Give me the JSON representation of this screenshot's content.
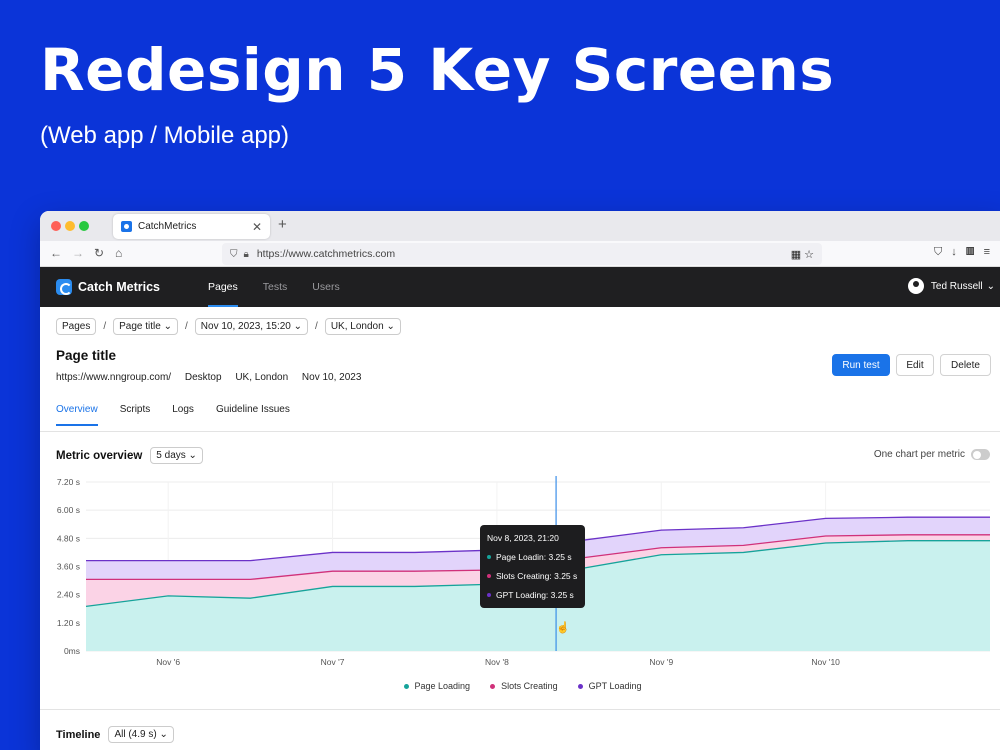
{
  "hero": {
    "title": "Redesign 5 Key Screens",
    "subtitle": "(Web app / Mobile app)"
  },
  "browser": {
    "tab_title": "CatchMetrics",
    "url": "https://www.catchmetrics.com"
  },
  "app": {
    "brand": "Catch Metrics",
    "nav": [
      "Pages",
      "Tests",
      "Users"
    ],
    "active_nav": "Pages",
    "user_name": "Ted Russell",
    "user_caret": "⌄"
  },
  "breadcrumb": {
    "root": "Pages",
    "page": "Page title",
    "date": "Nov 10, 2023, 15:20",
    "location": "UK, London",
    "caret": "⌄",
    "separator": "/"
  },
  "page": {
    "title": "Page title",
    "url": "https://www.nngroup.com/",
    "device": "Desktop",
    "location": "UK, London",
    "date": "Nov 10, 2023"
  },
  "actions": {
    "run": "Run test",
    "edit": "Edit",
    "delete": "Delete"
  },
  "tabs": [
    "Overview",
    "Scripts",
    "Logs",
    "Guideline Issues"
  ],
  "metric": {
    "title": "Metric overview",
    "range": "5 days",
    "per_metric_label": "One chart per metric",
    "per_metric_on": false
  },
  "tooltip": {
    "title": "Nov 8, 2023,  21:20",
    "rows": [
      {
        "label": "Page Loadin: 3.25 s",
        "color": "#16a39a"
      },
      {
        "label": "Slots Creating: 3.25 s",
        "color": "#d0317a"
      },
      {
        "label": "GPT Loading: 3.25 s",
        "color": "#6b32c8"
      }
    ]
  },
  "timeline": {
    "title": "Timeline",
    "range": "All (4.9 s)"
  },
  "chart_data": {
    "type": "area",
    "x": [
      "Nov 5 00:00",
      "Nov 6 00:00",
      "Nov 6 12:00",
      "Nov 7 00:00",
      "Nov 7 12:00",
      "Nov 8 00:00",
      "Nov 8 12:00",
      "Nov 9 00:00",
      "Nov 9 12:00",
      "Nov 10 00:00",
      "Nov 10 12:00",
      "Nov 11 00:00"
    ],
    "x_tick_labels": [
      "Nov '6",
      "Nov '7",
      "Nov '8",
      "Nov '9",
      "Nov '10"
    ],
    "y_tick_labels": [
      "0ms",
      "1.20 s",
      "2.40 s",
      "3.60 s",
      "4.80 s",
      "6.00 s",
      "7.20 s"
    ],
    "ylim": [
      0,
      7.2
    ],
    "stacked_display": true,
    "series": [
      {
        "name": "Page Loading",
        "color": "#16a39a",
        "fill": "#c9f1ee",
        "values": [
          1.9,
          2.35,
          2.25,
          2.75,
          2.75,
          2.85,
          3.5,
          4.1,
          4.2,
          4.6,
          4.7,
          4.7
        ]
      },
      {
        "name": "Slots Creating",
        "color": "#d0317a",
        "fill": "#fbd3e6",
        "values": [
          3.05,
          3.05,
          3.05,
          3.4,
          3.4,
          3.45,
          3.95,
          4.4,
          4.5,
          4.9,
          4.95,
          4.95
        ]
      },
      {
        "name": "GPT Loading",
        "color": "#6b32c8",
        "fill": "#e2d4fb",
        "values": [
          3.85,
          3.85,
          3.85,
          4.2,
          4.2,
          4.3,
          4.7,
          5.15,
          5.25,
          5.65,
          5.7,
          5.7
        ]
      }
    ],
    "legend_position": "bottom-center",
    "grid": true,
    "hover_x": "Nov 8, 2023, 21:20"
  }
}
